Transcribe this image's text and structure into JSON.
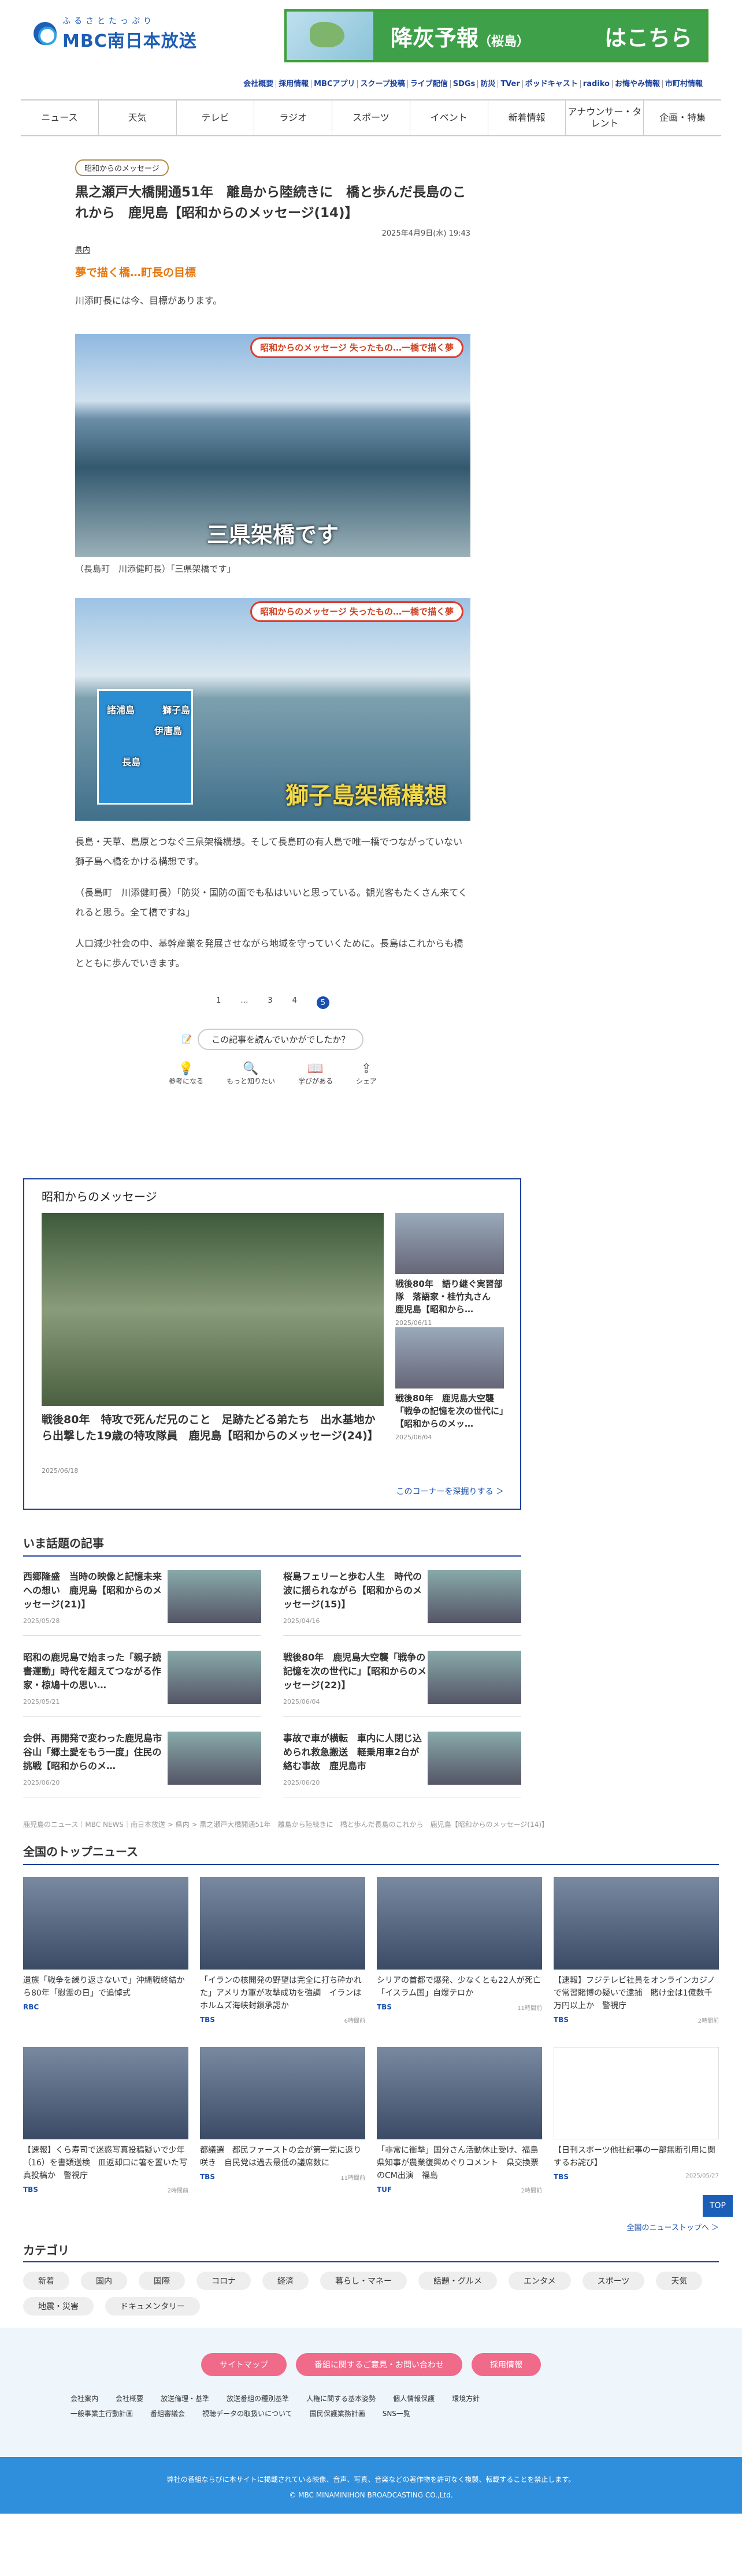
{
  "header": {
    "logo_ruby": "ふるさとたっぷり",
    "logo_name": "MBC南日本放送",
    "banner_title": "降灰予報",
    "banner_area": "（桜島）",
    "banner_cta": "はこちら"
  },
  "toplinks": [
    "会社概要",
    "採用情報",
    "MBCアプリ",
    "スクープ投稿",
    "ライブ配信",
    "SDGs",
    "防災",
    "TVer",
    "ポッドキャスト",
    "radiko",
    "お悔やみ情報",
    "市町村情報"
  ],
  "gnav": [
    "ニュース",
    "天気",
    "テレビ",
    "ラジオ",
    "スポーツ",
    "イベント",
    "新着情報",
    "アナウンサー・タレント",
    "企画・特集"
  ],
  "article": {
    "tag": "昭和からのメッセージ",
    "title": "黒之瀬戸大橋開通51年　離島から陸続きに　橋と歩んだ長島のこれから　鹿児島【昭和からのメッセージ(14)】",
    "date": "2025年4月9日(水) 19:43",
    "category": "県内",
    "lead": "夢で描く橋…町長の目標",
    "p1": "川添町長には今、目標があります。",
    "img1_badge": "昭和からのメッセージ 失ったもの…一橋で描く夢",
    "img1_caption": "三県架橋です",
    "img1_credit": "（長島町　川添健町長）「三県架橋です」",
    "img2_badge": "昭和からのメッセージ 失ったもの…一橋で描く夢",
    "img2_caption": "獅子島架橋構想",
    "map_labels": [
      "鹿児島",
      "長島",
      "獅子島",
      "伊唐島",
      "諸浦島"
    ],
    "p2": "長島・天草、島原とつなぐ三県架橋構想。そして長島町の有人島で唯一橋でつながっていない獅子島へ橋をかける構想です。",
    "p3": "（長島町　川添健町長）「防災・国防の面でも私はいいと思っている。観光客もたくさん来てくれると思う。全て橋ですね」",
    "p4": "人口減少社会の中、基幹産業を発展させながら地域を守っていくために。長島はこれからも橋とともに歩んでいきます。"
  },
  "pager": [
    "1",
    "…",
    "3",
    "4",
    "5"
  ],
  "feedback": {
    "question": "この記事を読んでいかがでしたか？",
    "items": [
      "参考になる",
      "もっと知りたい",
      "学びがある",
      "シェア"
    ]
  },
  "series": {
    "title": "昭和からのメッセージ",
    "main_title": "戦後80年　特攻で死んだ兄のこと　足跡たどる弟たち　出水基地から出撃した19歳の特攻隊員　鹿児島【昭和からのメッセージ(24)】",
    "main_date": "2025/06/18",
    "side": [
      {
        "title": "戦後80年　語り継ぐ実習部隊　落語家・桂竹丸さん　鹿児島【昭和から…",
        "date": "2025/06/11"
      },
      {
        "title": "戦後80年　鹿児島大空襲「戦争の記憶を次の世代に」【昭和からのメッ…",
        "date": "2025/06/04"
      }
    ],
    "more": "このコーナーを深掘りする ＞"
  },
  "trending": {
    "title": "いま話題の記事",
    "items": [
      {
        "title": "西郷隆盛　当時の映像と記憶未来への想い　鹿児島【昭和からのメッセージ(21)】",
        "date": "2025/05/28"
      },
      {
        "title": "桜島フェリーと歩む人生　時代の波に揺られながら【昭和からのメッセージ(15)】",
        "date": "2025/04/16"
      },
      {
        "title": "昭和の鹿児島で始まった「親子読書運動」時代を超えてつながる作家・椋鳩十の思い…",
        "date": "2025/05/21"
      },
      {
        "title": "戦後80年　鹿児島大空襲「戦争の記憶を次の世代に」【昭和からのメッセージ(22)】",
        "date": "2025/06/04"
      },
      {
        "title": "会併、再開発で変わった鹿児島市谷山「郷土愛をもう一度」住民の挑戦【昭和からのメ…",
        "date": "2025/06/20"
      },
      {
        "title": "事故で車が横転　車内に人閉じ込められ救急搬送　軽乗用車2台が絡む事故　鹿児島市",
        "date": "2025/06/20"
      }
    ]
  },
  "breadcrumb": "鹿児島のニュース｜MBC NEWS｜南日本放送 > 県内 > 黒之瀬戸大橋開通51年　離島から陸続きに　橋と歩んだ長島のこれから　鹿児島【昭和からのメッセージ(14)】",
  "topnews": {
    "title": "全国のトップニュース",
    "items": [
      {
        "title": "遺族「戦争を繰り返さないで」沖縄戦終結から80年「慰霊の日」で追悼式",
        "src": "RBC",
        "date": ""
      },
      {
        "title": "「イランの核開発の野望は完全に打ち砕かれた」アメリカ軍が攻撃成功を強調　イランはホルムズ海峡封鎖承認か",
        "src": "TBS",
        "date": "6時間前"
      },
      {
        "title": "シリアの首都で爆発、少なくとも22人が死亡「イスラム国」自爆テロか",
        "src": "TBS",
        "date": "11時間前"
      },
      {
        "title": "【速報】フジテレビ社員をオンラインカジノで常習賭博の疑いで逮捕　賭け金は1億数千万円以上か　警視庁",
        "src": "TBS",
        "date": "2時間前"
      },
      {
        "title": "【速報】くら寿司で迷惑写真投稿疑いで少年（16）を書類送検　皿返却口に箸を置いた写真投稿か　警視庁",
        "src": "TBS",
        "date": "2時間前"
      },
      {
        "title": "都議選　都民ファーストの会が第一党に返り咲き　自民党は過去最低の議席数に",
        "src": "TBS",
        "date": "11時間前"
      },
      {
        "title": "「非常に衝撃」国分さん活動休止受け、福島県知事が農業復興めぐりコメント　県交換票のCM出演　福島",
        "src": "TUF",
        "date": "2時間前"
      },
      {
        "title": "【日刊スポーツ他社記事の一部無断引用に関するお詫び】",
        "src": "TBS",
        "date": "2025/05/27"
      }
    ],
    "more": "全国のニューストップへ ＞",
    "top_btn": "TOP"
  },
  "categories": {
    "title": "カテゴリ",
    "items": [
      "新着",
      "国内",
      "国際",
      "コロナ",
      "経済",
      "暮らし・マネー",
      "話題・グルメ",
      "エンタメ",
      "スポーツ",
      "天気",
      "地震・災害",
      "ドキュメンタリー"
    ]
  },
  "footer": {
    "buttons": [
      "サイトマップ",
      "番組に関するご意見・お問い合わせ",
      "採用情報"
    ],
    "links": [
      "会社案内",
      "会社概要",
      "放送倫理・基準",
      "放送番組の種別基準",
      "人権に関する基本姿勢",
      "個人情報保護",
      "環境方針",
      "一般事業主行動計画",
      "番組審議会",
      "視聴データの取扱いについて",
      "国民保護業務計画",
      "SNS一覧"
    ],
    "notice": "弊社の番組ならびに本サイトに掲載されている映像、音声、写真、音楽などの著作物を許可なく複製、転載することを禁止します。",
    "copyright": "© MBC MINAMINIHON BROADCASTING CO.,Ltd."
  }
}
